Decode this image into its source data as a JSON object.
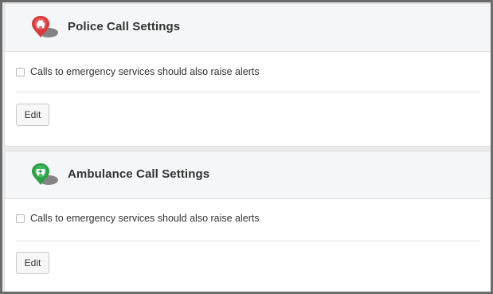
{
  "panels": [
    {
      "id": "police",
      "title": "Police Call Settings",
      "icon": "police-car-pin-icon",
      "icon_color": "#d93a3a",
      "checkbox_label": "Calls to emergency services should also raise alerts",
      "checkbox_checked": false,
      "edit_label": "Edit"
    },
    {
      "id": "ambulance",
      "title": "Ambulance Call Settings",
      "icon": "ambulance-pin-icon",
      "icon_color": "#2f9e4a",
      "checkbox_label": "Calls to emergency services should also raise alerts",
      "checkbox_checked": false,
      "edit_label": "Edit"
    }
  ]
}
